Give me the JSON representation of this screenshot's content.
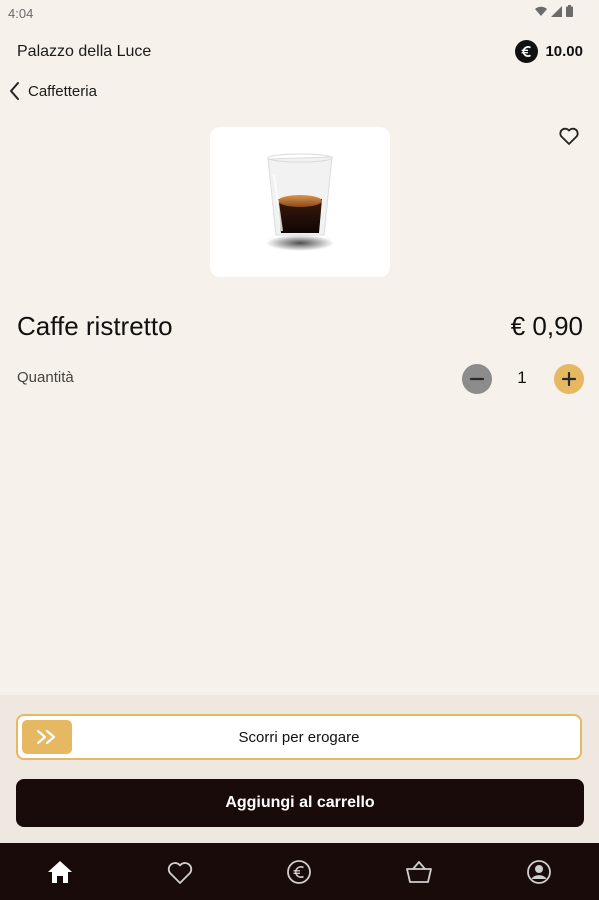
{
  "status": {
    "time": "4:04"
  },
  "header": {
    "venue": "Palazzo della Luce",
    "balance": "10.00"
  },
  "nav_back": {
    "label": "Caffetteria"
  },
  "product": {
    "name": "Caffe ristretto",
    "price": "€ 0,90",
    "quantity_label": "Quantità",
    "quantity": "1",
    "image_icon": "espresso-cup"
  },
  "actions": {
    "slide_label": "Scorri per erogare",
    "add_cart_label": "Aggiungi al carrello"
  },
  "bottom_nav": [
    "home-icon",
    "heart-icon",
    "euro-icon",
    "basket-icon",
    "profile-icon"
  ],
  "colors": {
    "accent": "#e7b862",
    "dark": "#1a0b0b",
    "background": "#f7f1eb"
  }
}
